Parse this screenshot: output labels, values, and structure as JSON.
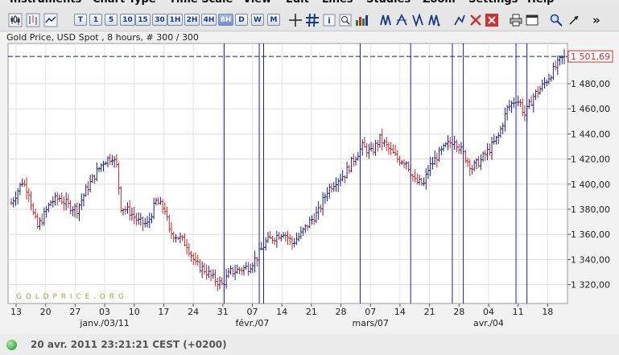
{
  "menu": [
    "Instruments",
    "Chart Type",
    "Time Scale",
    "View",
    "Edit",
    "Lines",
    "Studies",
    "Zoom",
    "Settings",
    "Help"
  ],
  "toolbar": {
    "timeframes": [
      "T",
      "1",
      "5",
      "10",
      "15",
      "30",
      "1H",
      "2H",
      "4H",
      "8H",
      "D",
      "W",
      "M"
    ],
    "active_timeframe": "8H",
    "more_label": "»"
  },
  "chart_header": "Gold Price, USD Spot , 8 hours, # 300 / 300",
  "watermark": "G O L D P R I C E . O R G",
  "current_price_label": "1 501,69",
  "status": "20 avr. 2011 23:21:21  CEST (+0200)",
  "colors": {
    "up": "#1a237e",
    "down": "#c62828",
    "vline": "#1c1cc8",
    "price_box": "#d32f2f"
  },
  "chart_data": {
    "type": "bar",
    "subtype": "ohlc",
    "ylim": [
      1305,
      1512
    ],
    "y_ticks": [
      1320,
      1340,
      1360,
      1380,
      1400,
      1420,
      1440,
      1460,
      1480
    ],
    "y_tick_labels": [
      "1 320,00",
      "1 340,00",
      "1 360,00",
      "1 380,00",
      "1 400,00",
      "1 420,00",
      "1 440,00",
      "1 460,00",
      "1 480,00"
    ],
    "current_price": 1501.69,
    "x_day_ticks": [
      "13",
      "20",
      "27",
      "03",
      "10",
      "17",
      "24",
      "31",
      "07",
      "14",
      "21",
      "28",
      "07",
      "14",
      "21",
      "28",
      "04",
      "11",
      "18"
    ],
    "x_month_labels": [
      {
        "label": "janv./03/11",
        "at_tick": 3
      },
      {
        "label": "févr./07",
        "at_tick": 8
      },
      {
        "label": "mars/07",
        "at_tick": 12
      },
      {
        "label": "avr./04",
        "at_tick": 16
      }
    ],
    "vertical_lines_at_bar": [
      97,
      113,
      115,
      159,
      182,
      201,
      206,
      230,
      235
    ],
    "anchors": [
      [
        0,
        1385
      ],
      [
        5,
        1402
      ],
      [
        8,
        1394
      ],
      [
        10,
        1376
      ],
      [
        12,
        1366
      ],
      [
        14,
        1372
      ],
      [
        18,
        1386
      ],
      [
        22,
        1389
      ],
      [
        26,
        1383
      ],
      [
        30,
        1380
      ],
      [
        34,
        1395
      ],
      [
        38,
        1407
      ],
      [
        42,
        1418
      ],
      [
        46,
        1422
      ],
      [
        48,
        1414
      ],
      [
        50,
        1382
      ],
      [
        54,
        1378
      ],
      [
        58,
        1370
      ],
      [
        62,
        1368
      ],
      [
        66,
        1386
      ],
      [
        70,
        1380
      ],
      [
        72,
        1362
      ],
      [
        76,
        1358
      ],
      [
        80,
        1352
      ],
      [
        84,
        1336
      ],
      [
        88,
        1332
      ],
      [
        92,
        1325
      ],
      [
        96,
        1320
      ],
      [
        100,
        1330
      ],
      [
        104,
        1332
      ],
      [
        108,
        1334
      ],
      [
        112,
        1342
      ],
      [
        116,
        1354
      ],
      [
        120,
        1358
      ],
      [
        124,
        1362
      ],
      [
        128,
        1353
      ],
      [
        132,
        1360
      ],
      [
        136,
        1370
      ],
      [
        140,
        1378
      ],
      [
        144,
        1395
      ],
      [
        148,
        1403
      ],
      [
        152,
        1408
      ],
      [
        156,
        1420
      ],
      [
        160,
        1430
      ],
      [
        164,
        1425
      ],
      [
        168,
        1436
      ],
      [
        172,
        1428
      ],
      [
        176,
        1420
      ],
      [
        180,
        1418
      ],
      [
        184,
        1402
      ],
      [
        188,
        1400
      ],
      [
        190,
        1412
      ],
      [
        194,
        1422
      ],
      [
        198,
        1430
      ],
      [
        202,
        1436
      ],
      [
        206,
        1424
      ],
      [
        210,
        1413
      ],
      [
        214,
        1419
      ],
      [
        218,
        1428
      ],
      [
        222,
        1438
      ],
      [
        226,
        1460
      ],
      [
        230,
        1468
      ],
      [
        232,
        1464
      ],
      [
        234,
        1455
      ],
      [
        238,
        1470
      ],
      [
        242,
        1478
      ],
      [
        246,
        1488
      ],
      [
        250,
        1498
      ],
      [
        252,
        1501.69
      ]
    ]
  }
}
